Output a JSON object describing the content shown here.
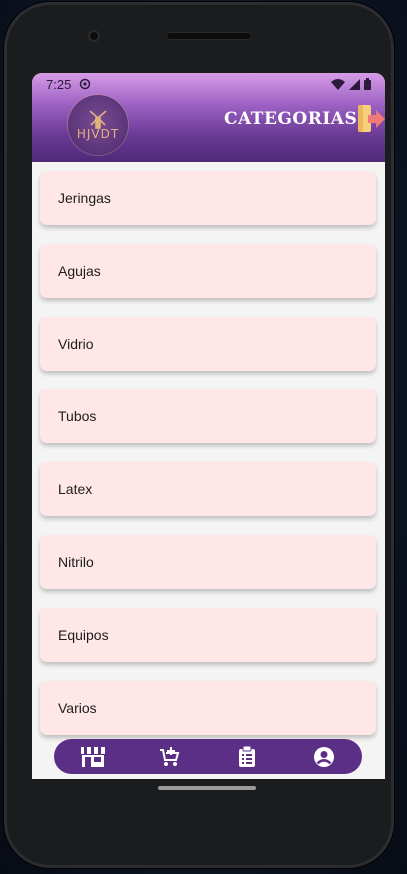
{
  "status_bar": {
    "time": "7:25"
  },
  "header": {
    "title": "CATEGORIAS",
    "logo_text": "HJVDT"
  },
  "categories": [
    {
      "label": "Jeringas"
    },
    {
      "label": "Agujas"
    },
    {
      "label": "Vidrio"
    },
    {
      "label": "Tubos"
    },
    {
      "label": "Latex"
    },
    {
      "label": "Nitrilo"
    },
    {
      "label": "Equipos"
    },
    {
      "label": "Varios"
    }
  ],
  "bottom_nav": {
    "items": [
      {
        "icon": "store-icon"
      },
      {
        "icon": "add-to-cart-icon"
      },
      {
        "icon": "clipboard-list-icon"
      },
      {
        "icon": "account-circle-icon"
      }
    ]
  },
  "colors": {
    "header_top": "#d79ce6",
    "header_bottom": "#4e2a78",
    "card_background": "#ffe7e7",
    "nav_background": "#5b2f86",
    "logout_accent": "#f07a7a"
  }
}
